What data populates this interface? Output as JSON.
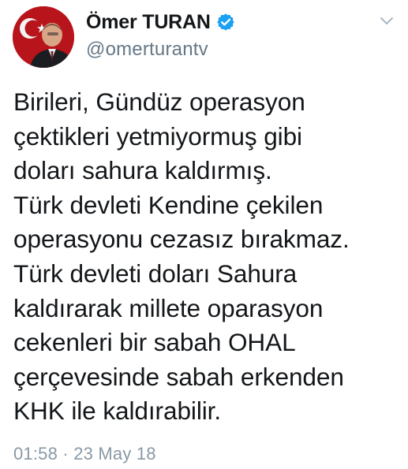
{
  "tweet": {
    "author": {
      "display_name": "Ömer TURAN",
      "handle": "@omerturantv",
      "verified": true
    },
    "lines": [
      "Birileri, Gündüz operasyon",
      "çektikleri yetmiyormuş gibi",
      "doları sahura kaldırmış.",
      "Türk devleti Kendine çekilen",
      "operasyonu cezasız bırakmaz.",
      "Türk devleti doları Sahura",
      "kaldırarak millete oparasyon",
      "cekenleri bir sabah OHAL",
      "çerçevesinde sabah erkenden",
      "KHK ile kaldırabilir."
    ],
    "timestamp": "01:58 · 23 May 18"
  },
  "icons": {
    "verified": "verified-badge-icon",
    "menu": "chevron-down-icon"
  },
  "colors": {
    "text": "#14171a",
    "secondary": "#657786",
    "timestamp": "#8899a6",
    "verified": "#1da1f2",
    "avatar_background": "#b8141b"
  }
}
